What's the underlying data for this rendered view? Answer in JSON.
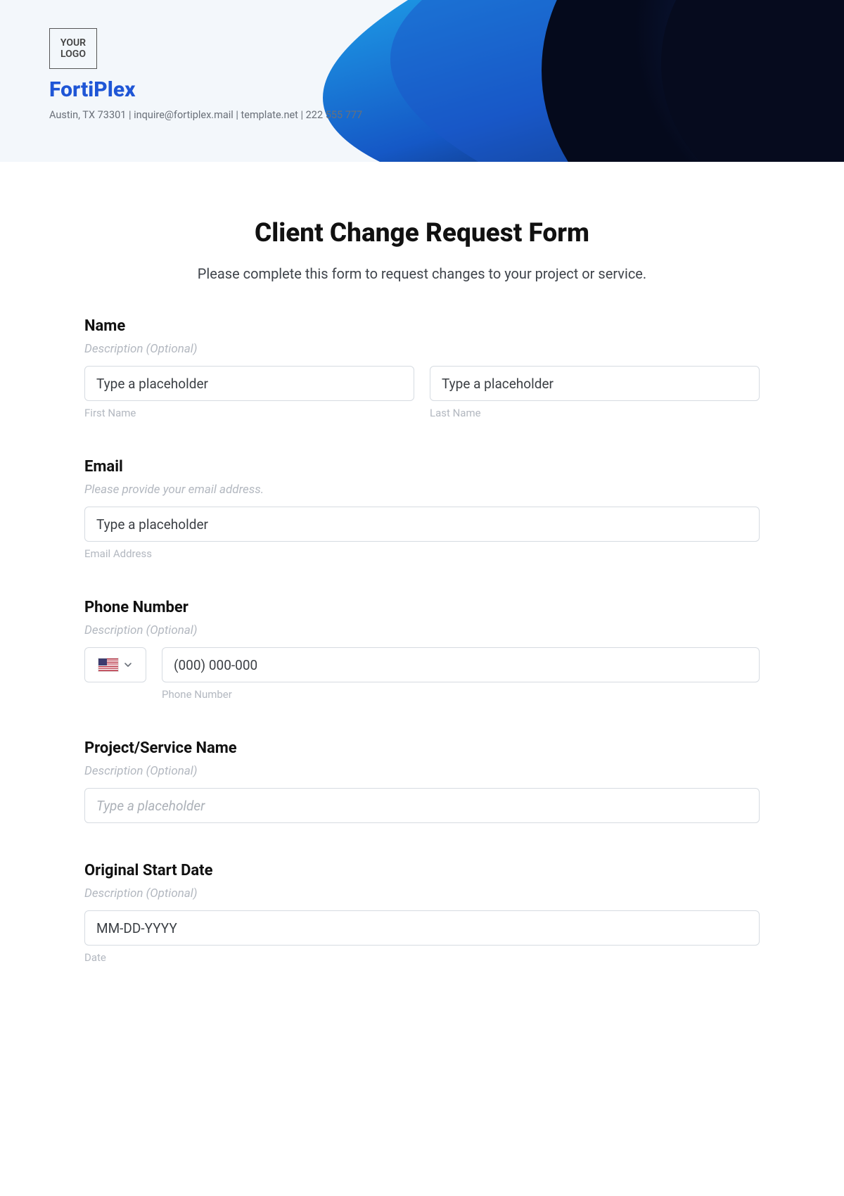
{
  "header": {
    "logo_text": "YOUR LOGO",
    "brand": "FortiPlex",
    "contact": "Austin, TX 73301 | inquire@fortiplex.mail | template.net | 222 555 777"
  },
  "form": {
    "title": "Client Change Request Form",
    "subtitle": "Please complete this form to request changes to your project or service.",
    "name": {
      "label": "Name",
      "desc": "Description (Optional)",
      "first_ph": "Type a placeholder",
      "first_sub": "First Name",
      "last_ph": "Type a placeholder",
      "last_sub": "Last Name"
    },
    "email": {
      "label": "Email",
      "desc": "Please provide your email address.",
      "ph": "Type a placeholder",
      "sub": "Email Address"
    },
    "phone": {
      "label": "Phone Number",
      "desc": "Description (Optional)",
      "ph": "(000) 000-000",
      "sub": "Phone Number"
    },
    "project": {
      "label": "Project/Service Name",
      "desc": "Description (Optional)",
      "ph": "Type a placeholder"
    },
    "startdate": {
      "label": "Original Start Date",
      "desc": "Description (Optional)",
      "ph": "MM-DD-YYYY",
      "sub": "Date"
    }
  }
}
